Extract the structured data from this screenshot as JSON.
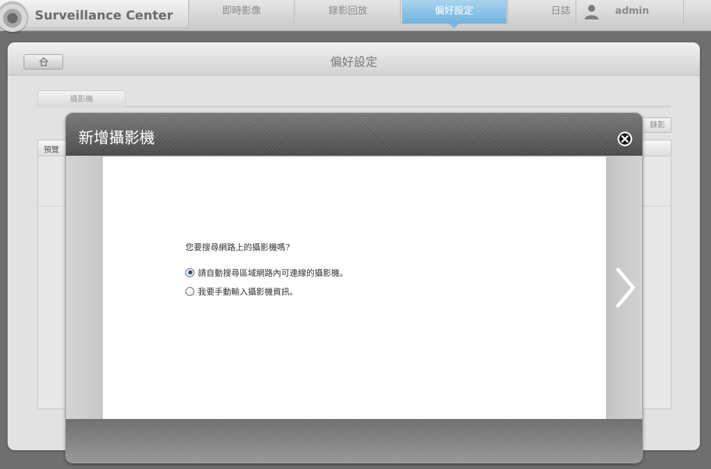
{
  "app": {
    "title": "Surveillance Center"
  },
  "nav": {
    "tabs": [
      {
        "label": "即時影像",
        "active": false
      },
      {
        "label": "錄影回放",
        "active": false
      },
      {
        "label": "偏好設定",
        "active": true
      }
    ],
    "log_label": "日誌",
    "username": "admin"
  },
  "panel": {
    "title": "偏好設定",
    "sub_tab": "攝影機",
    "record_button": "錄影",
    "table_header": "預覽"
  },
  "modal": {
    "title": "新增攝影機",
    "question": "您要搜尋網路上的攝影機嗎?",
    "options": [
      {
        "label": "請自動搜尋區域網路內可連線的攝影機。",
        "checked": true
      },
      {
        "label": "我要手動輸入攝影機資訊。",
        "checked": false
      }
    ]
  },
  "colors": {
    "accent": "#6fb3df",
    "modal_header": "#5a5a5a",
    "radio_selected": "#1f4f8e"
  },
  "icons": {
    "brand": "camera-icon",
    "user": "user-icon",
    "home": "home-icon",
    "close": "close-circle-icon",
    "next": "chevron-right-icon"
  }
}
